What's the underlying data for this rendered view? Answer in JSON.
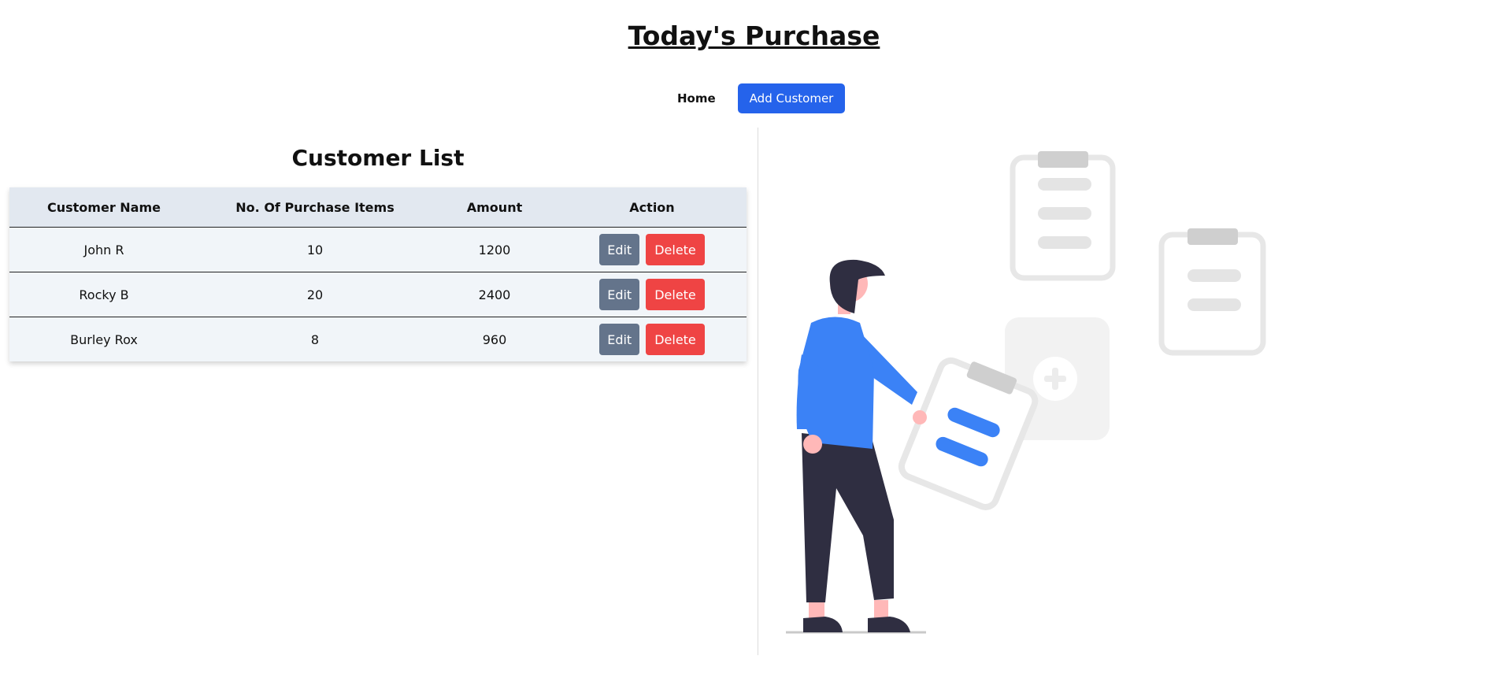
{
  "header": {
    "title": "Today's Purchase"
  },
  "nav": {
    "home_label": "Home",
    "add_customer_label": "Add Customer"
  },
  "customer_list": {
    "title": "Customer List",
    "columns": [
      "Customer Name",
      "No. Of Purchase Items",
      "Amount",
      "Action"
    ],
    "rows": [
      {
        "name": "John R",
        "items": "10",
        "amount": "1200"
      },
      {
        "name": "Rocky B",
        "items": "20",
        "amount": "2400"
      },
      {
        "name": "Burley Rox",
        "items": "8",
        "amount": "960"
      }
    ],
    "edit_label": "Edit",
    "delete_label": "Delete"
  },
  "colors": {
    "primary": "#2563eb",
    "edit": "#64748b",
    "delete": "#ef4444",
    "header_bg": "#e2e8f0",
    "row_bg": "#f1f5f9",
    "figure_accent": "#3b82f6"
  },
  "illustration": {
    "icon": "person-holding-clipboard-illustration"
  }
}
